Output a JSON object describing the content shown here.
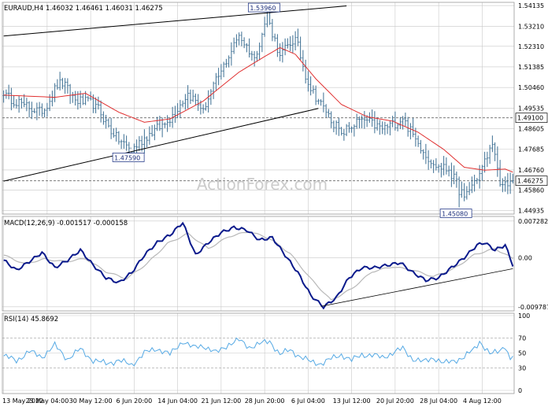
{
  "chart_data": [
    {
      "panel": "price",
      "type": "line",
      "series_kind": "bars",
      "title": "EURAUD,H4  1.46032 1.46461 1.46031 1.46275",
      "watermark": "ActionForex.com",
      "y_ticks": [
        "1.54135",
        "1.53210",
        "1.52310",
        "1.51385",
        "1.50460",
        "1.49535",
        "1.48605",
        "1.47685",
        "1.46760",
        "1.45860",
        "1.44935"
      ],
      "y_tick_values": [
        1.54135,
        1.5321,
        1.5231,
        1.51385,
        1.5046,
        1.49535,
        1.48605,
        1.47685,
        1.4676,
        1.4586,
        1.44935
      ],
      "ylim": [
        1.4478,
        1.5428
      ],
      "bar_count": 200,
      "level_lines": [
        1.491,
        1.46275
      ],
      "level_labels": [
        "1.49100",
        "1.46275"
      ],
      "annotations": [
        {
          "text": "1.53960",
          "bar": 103,
          "value": 1.5396
        },
        {
          "text": "1.47590",
          "bar": 50,
          "value": 1.4759
        },
        {
          "text": "1.45080",
          "bar": 178,
          "value": 1.4508
        }
      ],
      "trendlines": [
        {
          "from": [
            0,
            1.5277
          ],
          "to": [
            134,
            1.5412
          ]
        },
        {
          "from": [
            0,
            1.4626
          ],
          "to": [
            123,
            1.4952
          ]
        }
      ],
      "close_keypoints": [
        [
          0,
          1.501
        ],
        [
          8,
          1.497
        ],
        [
          15,
          1.493
        ],
        [
          22,
          1.508
        ],
        [
          28,
          1.499
        ],
        [
          36,
          1.497
        ],
        [
          43,
          1.483
        ],
        [
          50,
          1.4765
        ],
        [
          57,
          1.484
        ],
        [
          64,
          1.489
        ],
        [
          72,
          1.502
        ],
        [
          78,
          1.495
        ],
        [
          85,
          1.512
        ],
        [
          92,
          1.528
        ],
        [
          98,
          1.518
        ],
        [
          103,
          1.536
        ],
        [
          108,
          1.519
        ],
        [
          114,
          1.527
        ],
        [
          119,
          1.506
        ],
        [
          126,
          1.4935
        ],
        [
          132,
          1.484
        ],
        [
          140,
          1.4905
        ],
        [
          148,
          1.486
        ],
        [
          156,
          1.4905
        ],
        [
          162,
          1.4795
        ],
        [
          168,
          1.47
        ],
        [
          174,
          1.4675
        ],
        [
          180,
          1.4555
        ],
        [
          186,
          1.466
        ],
        [
          191,
          1.479
        ],
        [
          194,
          1.461
        ],
        [
          199,
          1.46275
        ]
      ],
      "ma_keypoints": [
        [
          0,
          1.5012
        ],
        [
          20,
          1.5002
        ],
        [
          32,
          1.502
        ],
        [
          45,
          1.4935
        ],
        [
          55,
          1.489
        ],
        [
          65,
          1.4905
        ],
        [
          78,
          1.4985
        ],
        [
          92,
          1.5115
        ],
        [
          102,
          1.5185
        ],
        [
          108,
          1.5225
        ],
        [
          114,
          1.5195
        ],
        [
          122,
          1.5085
        ],
        [
          132,
          1.497
        ],
        [
          142,
          1.4915
        ],
        [
          152,
          1.4895
        ],
        [
          162,
          1.4845
        ],
        [
          172,
          1.4768
        ],
        [
          180,
          1.4688
        ],
        [
          188,
          1.4675
        ],
        [
          196,
          1.468
        ],
        [
          199,
          1.4666
        ]
      ]
    },
    {
      "panel": "macd",
      "type": "line",
      "title": "MACD(12,26,9) -0.001517 -0.000158",
      "y_ticks": [
        "0.007282",
        "0.00",
        "-0.009787"
      ],
      "y_tick_values": [
        0.007282,
        0.0,
        -0.009787
      ],
      "ylim": [
        -0.0106,
        0.0082
      ],
      "macd_keypoints": [
        [
          0,
          -0.0005
        ],
        [
          5,
          -0.0025
        ],
        [
          10,
          -0.0008
        ],
        [
          15,
          0.001
        ],
        [
          20,
          -0.002
        ],
        [
          25,
          -0.0005
        ],
        [
          30,
          0.0015
        ],
        [
          35,
          -0.0015
        ],
        [
          40,
          -0.004
        ],
        [
          45,
          -0.005
        ],
        [
          50,
          -0.003
        ],
        [
          55,
          0.0005
        ],
        [
          60,
          0.003
        ],
        [
          65,
          0.0045
        ],
        [
          70,
          0.007
        ],
        [
          75,
          0.0005
        ],
        [
          80,
          0.003
        ],
        [
          85,
          0.005
        ],
        [
          90,
          0.006
        ],
        [
          95,
          0.0055
        ],
        [
          100,
          0.0035
        ],
        [
          105,
          0.004
        ],
        [
          110,
          0.0005
        ],
        [
          115,
          -0.003
        ],
        [
          120,
          -0.0075
        ],
        [
          125,
          -0.0098
        ],
        [
          130,
          -0.008
        ],
        [
          135,
          -0.004
        ],
        [
          140,
          -0.002
        ],
        [
          145,
          -0.002
        ],
        [
          150,
          -0.0015
        ],
        [
          155,
          -0.001
        ],
        [
          160,
          -0.003
        ],
        [
          165,
          -0.0045
        ],
        [
          170,
          -0.004
        ],
        [
          175,
          -0.002
        ],
        [
          180,
          0.0
        ],
        [
          185,
          0.0025
        ],
        [
          188,
          0.003
        ],
        [
          192,
          0.0015
        ],
        [
          196,
          0.0025
        ],
        [
          199,
          -0.0015
        ]
      ],
      "signal_keypoints": [
        [
          0,
          0.0005
        ],
        [
          8,
          -0.0012
        ],
        [
          16,
          -0.0003
        ],
        [
          24,
          -0.0008
        ],
        [
          32,
          -0.0002
        ],
        [
          40,
          -0.0028
        ],
        [
          48,
          -0.0042
        ],
        [
          56,
          -0.0012
        ],
        [
          64,
          0.0028
        ],
        [
          72,
          0.0048
        ],
        [
          80,
          0.0018
        ],
        [
          88,
          0.0042
        ],
        [
          96,
          0.0052
        ],
        [
          104,
          0.0038
        ],
        [
          112,
          0.0008
        ],
        [
          120,
          -0.0042
        ],
        [
          128,
          -0.0085
        ],
        [
          136,
          -0.0062
        ],
        [
          144,
          -0.0028
        ],
        [
          152,
          -0.0018
        ],
        [
          160,
          -0.0025
        ],
        [
          168,
          -0.0038
        ],
        [
          176,
          -0.0022
        ],
        [
          184,
          0.0006
        ],
        [
          192,
          0.0018
        ],
        [
          199,
          -0.0002
        ]
      ],
      "trendline": {
        "from": [
          124,
          -0.0097
        ],
        "to": [
          199,
          -0.0022
        ]
      }
    },
    {
      "panel": "rsi",
      "type": "line",
      "title": "RSI(14) 45.8692",
      "y_ticks": [
        "100",
        "70",
        "50",
        "30",
        "0"
      ],
      "y_tick_values": [
        100,
        70,
        50,
        30,
        0
      ],
      "ylim": [
        0,
        100
      ],
      "level_lines": [
        70,
        30
      ],
      "rsi_keypoints": [
        [
          0,
          46
        ],
        [
          5,
          40
        ],
        [
          10,
          52
        ],
        [
          15,
          45
        ],
        [
          20,
          60
        ],
        [
          25,
          42
        ],
        [
          30,
          55
        ],
        [
          35,
          40
        ],
        [
          40,
          36
        ],
        [
          45,
          40
        ],
        [
          50,
          34
        ],
        [
          55,
          50
        ],
        [
          60,
          56
        ],
        [
          65,
          48
        ],
        [
          70,
          66
        ],
        [
          74,
          57
        ],
        [
          78,
          60
        ],
        [
          83,
          50
        ],
        [
          88,
          62
        ],
        [
          92,
          67
        ],
        [
          96,
          58
        ],
        [
          100,
          62
        ],
        [
          104,
          66
        ],
        [
          108,
          48
        ],
        [
          112,
          54
        ],
        [
          116,
          45
        ],
        [
          120,
          38
        ],
        [
          124,
          36
        ],
        [
          128,
          42
        ],
        [
          132,
          48
        ],
        [
          136,
          40
        ],
        [
          140,
          48
        ],
        [
          144,
          47
        ],
        [
          148,
          44
        ],
        [
          152,
          50
        ],
        [
          156,
          56
        ],
        [
          160,
          42
        ],
        [
          164,
          38
        ],
        [
          168,
          44
        ],
        [
          172,
          36
        ],
        [
          176,
          40
        ],
        [
          180,
          44
        ],
        [
          184,
          56
        ],
        [
          186,
          66
        ],
        [
          190,
          48
        ],
        [
          193,
          52
        ],
        [
          196,
          60
        ],
        [
          198,
          40
        ],
        [
          199,
          45.87
        ]
      ]
    }
  ],
  "x_ticks": [
    "13 May 2022",
    "23 May 04:00",
    "30 May 12:00",
    "6 Jun 20:00",
    "14 Jun 04:00",
    "21 Jun 12:00",
    "28 Jun 20:00",
    "6 Jul 04:00",
    "13 Jul 12:00",
    "20 Jul 20:00",
    "28 Jul 04:00",
    "4 Aug 12:00"
  ],
  "x_tick_bars": [
    0,
    17,
    34,
    51,
    68,
    85,
    102,
    119,
    136,
    153,
    170,
    187
  ],
  "colors": {
    "bars": "#3d6f93",
    "moving_average": "#e03030",
    "macd_line": "#0a1a8c",
    "signal_line": "#b8b8b8",
    "rsi_line": "#55a9e4",
    "grid": "#c8c8c8",
    "frame": "#9a9a9a",
    "level_line": "#666666",
    "watermark": "#c8c8c8",
    "label_border": "#2b3f8c"
  }
}
